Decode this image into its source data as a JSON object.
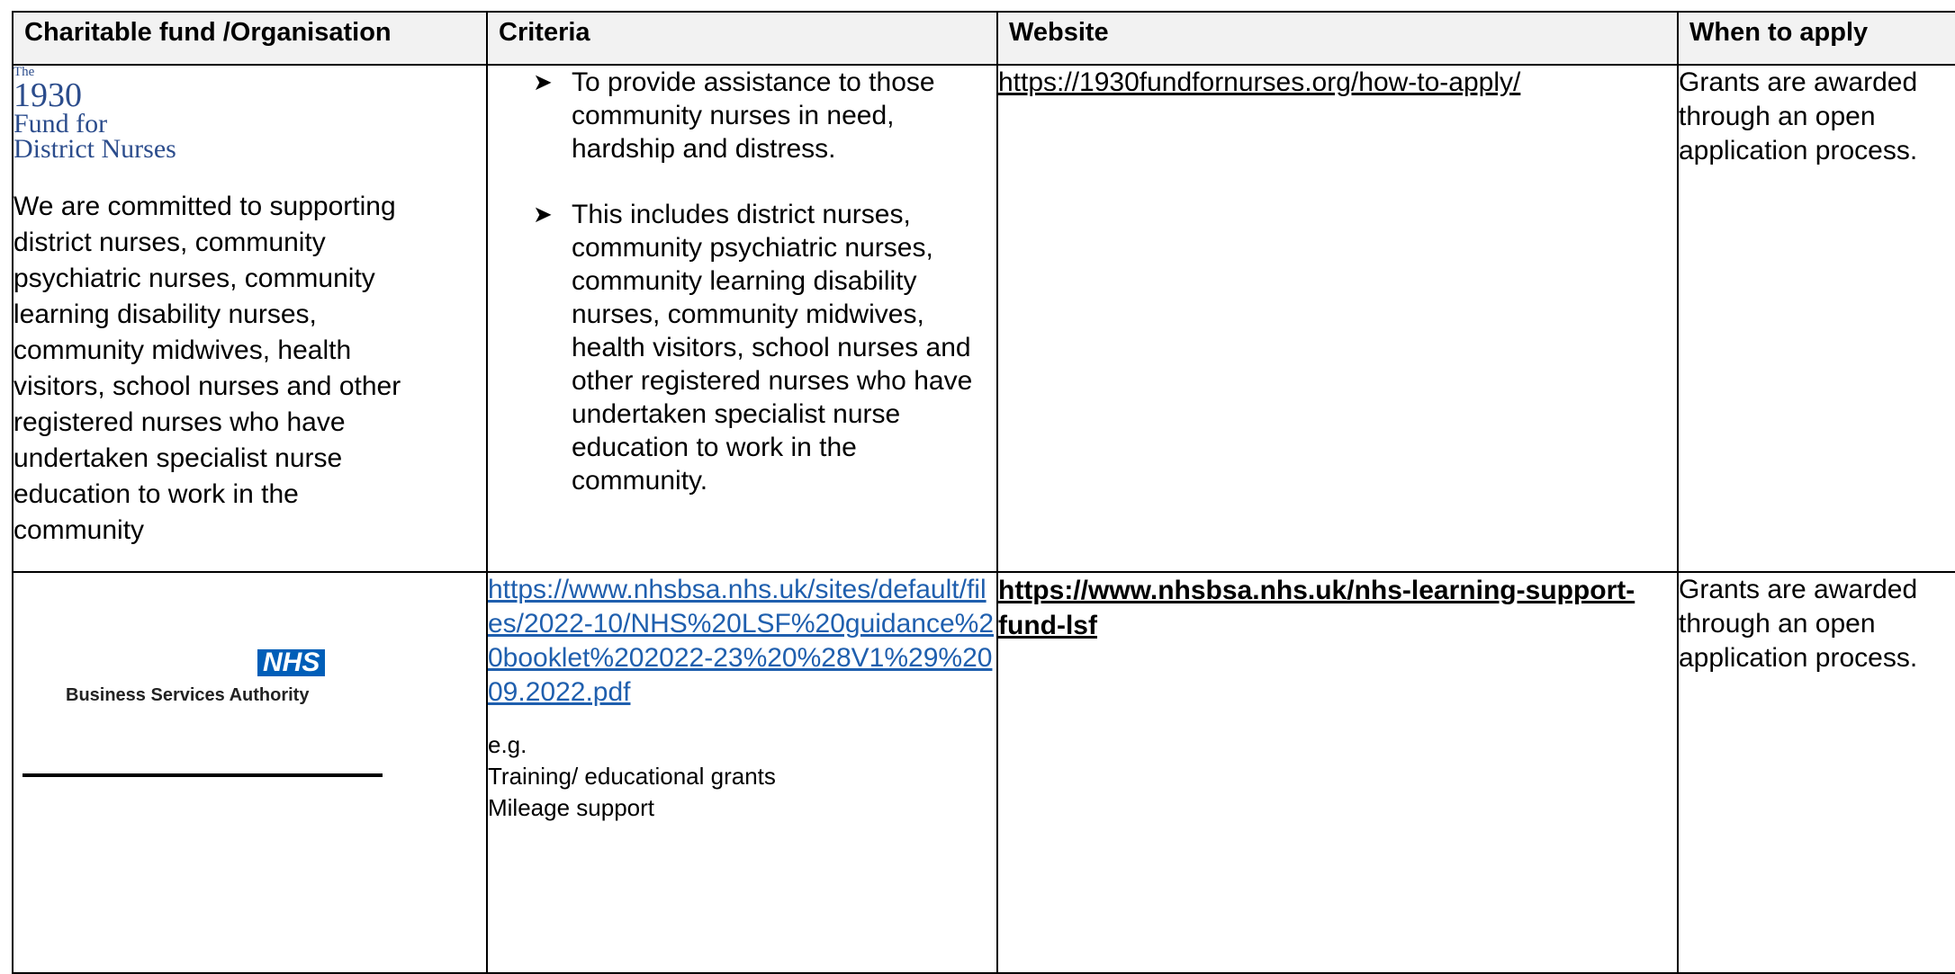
{
  "headers": {
    "organisation": "Charitable fund /Organisation",
    "criteria": "Criteria",
    "website": "Website",
    "when": "When to apply"
  },
  "rows": [
    {
      "logo": {
        "the": "The",
        "year": "1930",
        "line1": "Fund for",
        "line2": "District Nurses"
      },
      "description": "We are committed to supporting district nurses, community psychiatric nurses, community learning disability nurses, community midwives, health visitors, school nurses and other registered nurses who have undertaken specialist nurse education to work in the community",
      "criteria": [
        "To provide assistance to those community nurses in need, hardship and distress.",
        "This includes district nurses, community psychiatric nurses, community learning disability nurses, community midwives, health visitors, school nurses and other registered nurses who have undertaken specialist nurse education to work in the community."
      ],
      "website": "https://1930fundfornurses.org/how-to-apply/",
      "when": "Grants are awarded through an open application process."
    },
    {
      "logo": {
        "mark": "NHS",
        "name": "Business Services Authority"
      },
      "criteria_link": "https://www.nhsbsa.nhs.uk/sites/default/files/2022-10/NHS%20LSF%20guidance%20booklet%202022-23%20%28V1%29%2009.2022.pdf",
      "criteria_eg": "e.g.",
      "criteria_items": [
        "Training/ educational  grants",
        "Mileage support"
      ],
      "website": "https://www.nhsbsa.nhs.uk/nhs-learning-support-fund-lsf",
      "when": "Grants are awarded through an open application process."
    }
  ],
  "colors": {
    "header_bg": "#f2f2f2",
    "logo_blue": "#2b4c8c",
    "link_blue": "#1f5fae",
    "nhs_blue": "#005eb8"
  }
}
